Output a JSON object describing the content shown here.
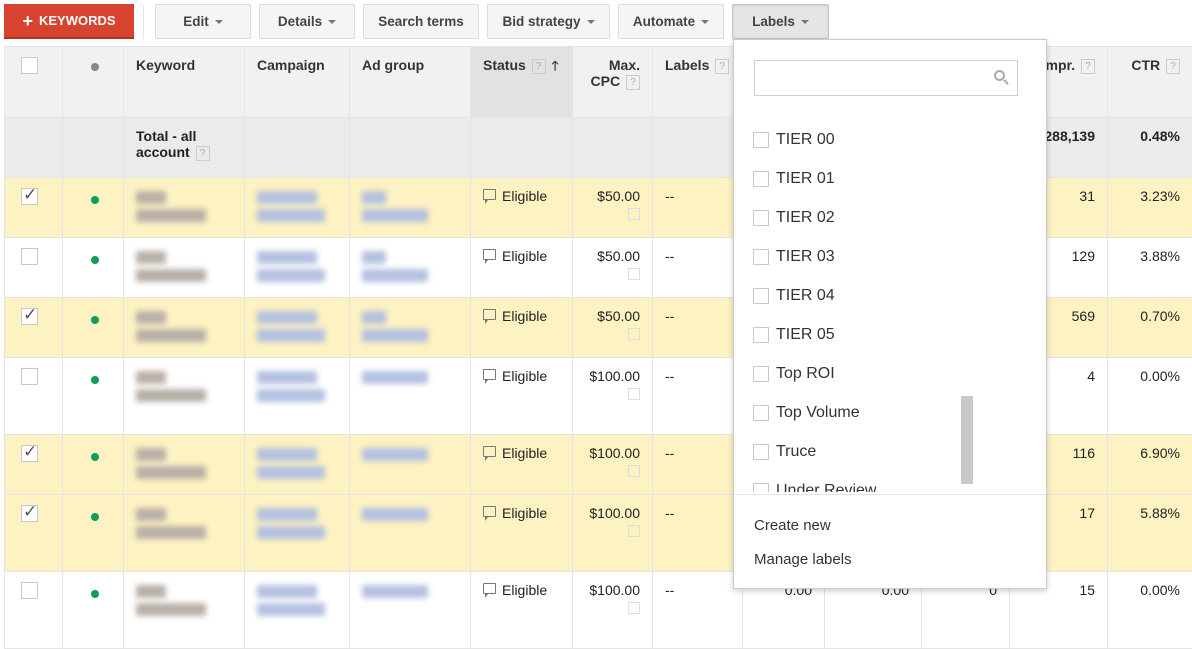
{
  "toolbar": {
    "add_keywords": "KEYWORDS",
    "buttons": [
      {
        "label": "Edit",
        "caret": true
      },
      {
        "label": "Details",
        "caret": true
      },
      {
        "label": "Search terms",
        "caret": false
      },
      {
        "label": "Bid strategy",
        "caret": true
      },
      {
        "label": "Automate",
        "caret": true
      },
      {
        "label": "Labels",
        "caret": true,
        "active": true
      }
    ]
  },
  "table": {
    "headers": {
      "keyword": "Keyword",
      "campaign": "Campaign",
      "ad_group": "Ad group",
      "status": "Status",
      "max_cpc_1": "Max.",
      "max_cpc_2": "CPC",
      "labels": "Labels",
      "impr": "Impr.",
      "ctr": "CTR",
      "help": "?"
    },
    "total": {
      "label_1": "Total - all",
      "label_2": "account",
      "impr": "288,139",
      "ctr": "0.48%"
    },
    "rows": [
      {
        "checked": true,
        "status": "Eligible",
        "max_cpc": "$50.00",
        "labels": "--",
        "impr": "31",
        "ctr": "3.23%"
      },
      {
        "checked": false,
        "status": "Eligible",
        "max_cpc": "$50.00",
        "labels": "--",
        "impr": "129",
        "ctr": "3.88%"
      },
      {
        "checked": true,
        "status": "Eligible",
        "max_cpc": "$50.00",
        "labels": "--",
        "impr": "569",
        "ctr": "0.70%"
      },
      {
        "checked": false,
        "status": "Eligible",
        "max_cpc": "$100.00",
        "labels": "--",
        "impr": "4",
        "ctr": "0.00%"
      },
      {
        "checked": true,
        "status": "Eligible",
        "max_cpc": "$100.00",
        "labels": "--",
        "impr": "116",
        "ctr": "6.90%"
      },
      {
        "checked": true,
        "status": "Eligible",
        "max_cpc": "$100.00",
        "labels": "--",
        "impr": "17",
        "ctr": "5.88%"
      },
      {
        "checked": false,
        "status": "Eligible",
        "max_cpc": "$100.00",
        "labels": "--",
        "hidden_1": "0.00",
        "hidden_2": "0.00",
        "hidden_3": "0",
        "impr": "15",
        "ctr": "0.00%"
      }
    ]
  },
  "labels_dropdown": {
    "search_placeholder": "",
    "items": [
      "TIER 00",
      "TIER 01",
      "TIER 02",
      "TIER 03",
      "TIER 04",
      "TIER 05",
      "Top ROI",
      "Top Volume",
      "Truce",
      "Under Review"
    ],
    "create_new": "Create new",
    "manage_labels": "Manage labels"
  }
}
